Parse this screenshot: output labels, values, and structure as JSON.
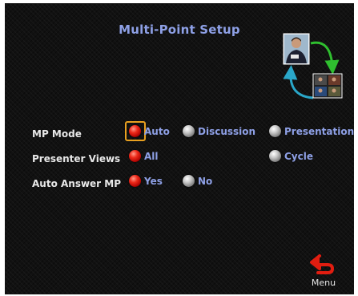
{
  "screen": {
    "title": "Multi-Point Setup"
  },
  "settings": {
    "mp_mode": {
      "label": "MP Mode",
      "options": [
        "Auto",
        "Discussion",
        "Presentation"
      ],
      "selected": "Auto"
    },
    "presenter_views": {
      "label": "Presenter Views",
      "options": [
        "All",
        "Cycle"
      ],
      "selected": "All"
    },
    "auto_answer_mp": {
      "label": "Auto Answer MP",
      "options": [
        "Yes",
        "No"
      ],
      "selected": "Yes"
    }
  },
  "menu": {
    "label": "Menu",
    "icon": "back-arrow-icon"
  },
  "colors": {
    "background": "#111111",
    "accent_text": "#8ea0e6",
    "label_text": "#e8e8e8",
    "selected_radio": "#e21d10",
    "focus_ring": "#e8a020"
  }
}
